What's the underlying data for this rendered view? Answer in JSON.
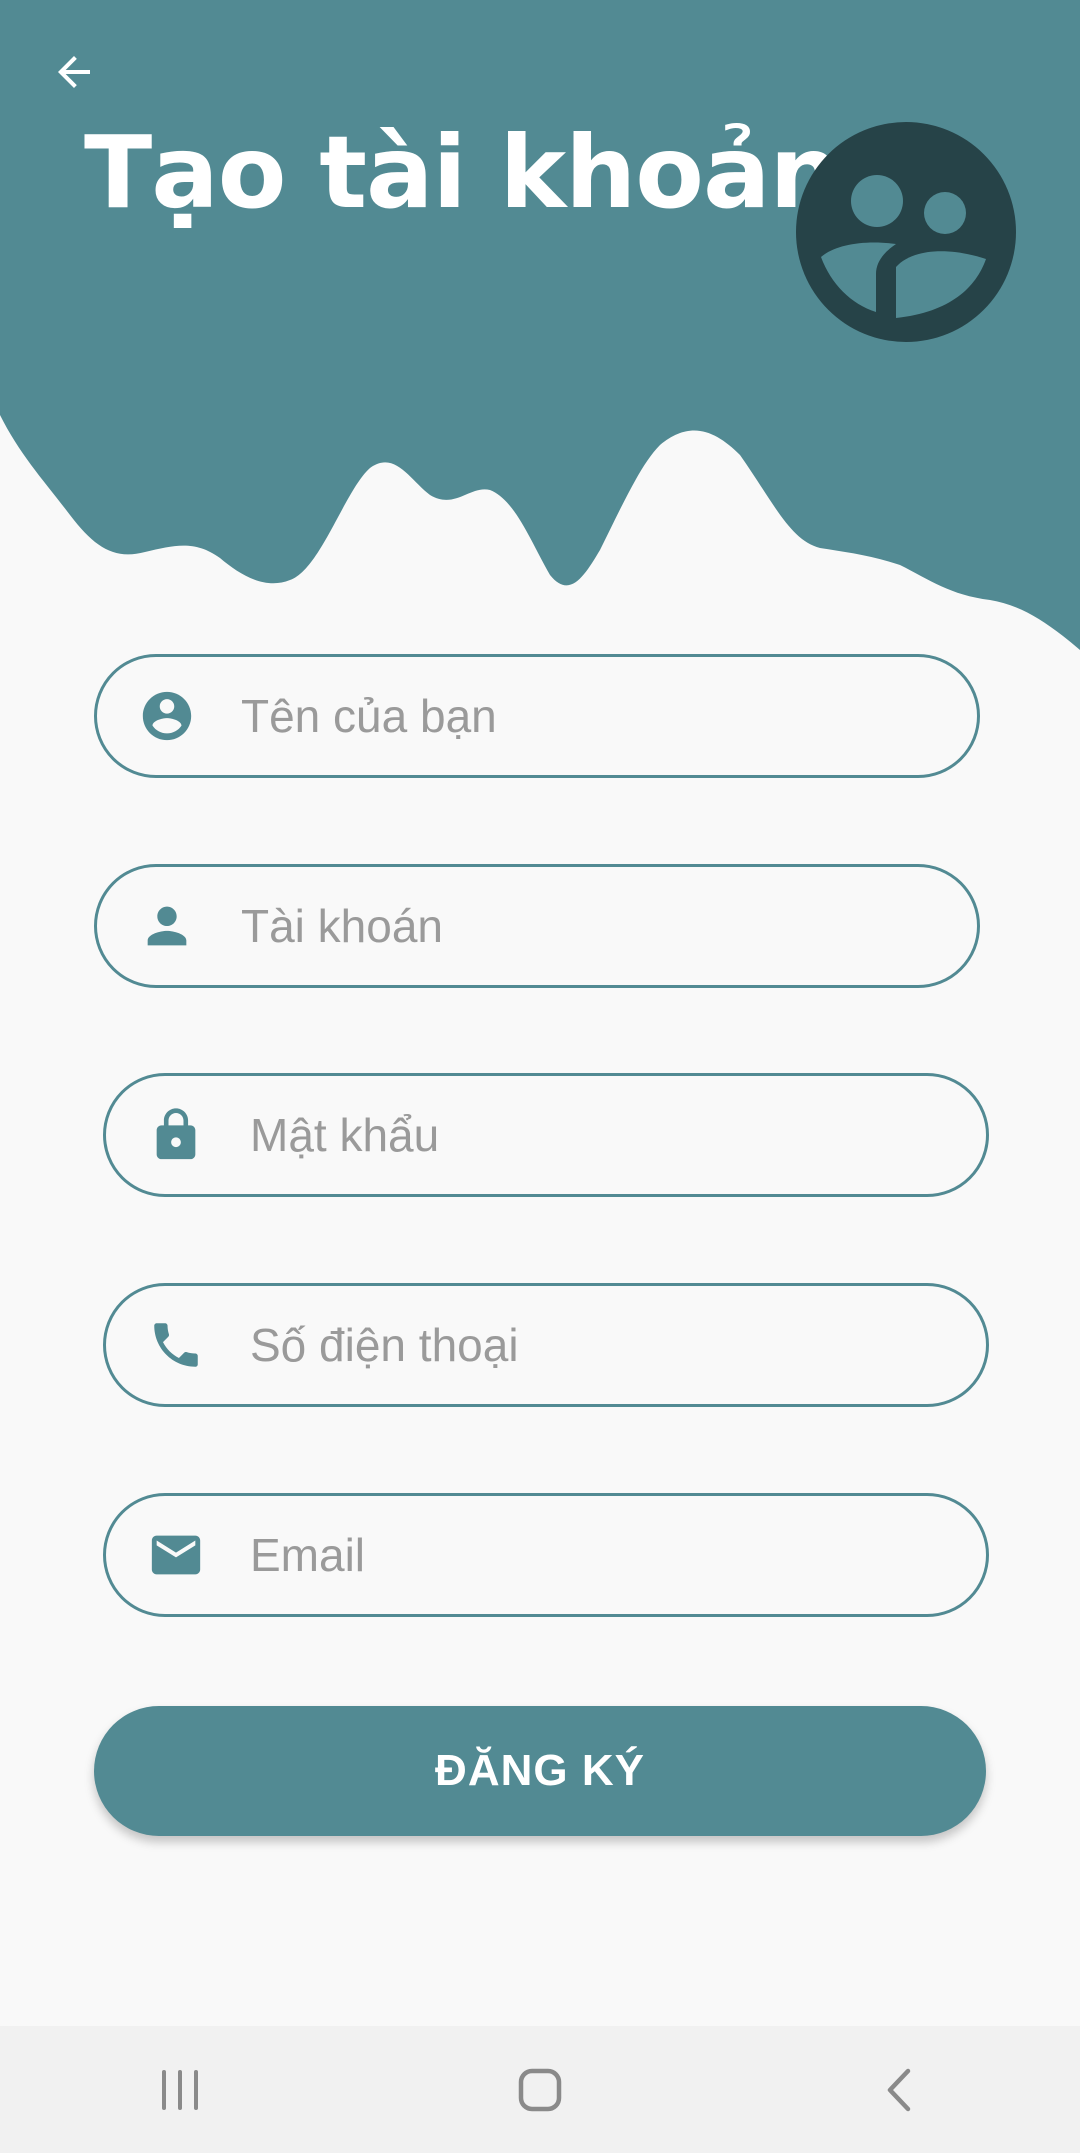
{
  "header": {
    "title": "Tạo tài khoản",
    "back_icon": "arrow-left-icon",
    "badge_icon": "supervisor-account-icon"
  },
  "form": {
    "fields": [
      {
        "icon": "account-circle-icon",
        "placeholder": "Tên của bạn",
        "value": ""
      },
      {
        "icon": "person-icon",
        "placeholder": "Tài khoán",
        "value": ""
      },
      {
        "icon": "lock-icon",
        "placeholder": "Mật khẩu",
        "value": ""
      },
      {
        "icon": "phone-icon",
        "placeholder": "Số điện thoại",
        "value": ""
      },
      {
        "icon": "email-icon",
        "placeholder": "Email",
        "value": ""
      }
    ],
    "submit_label": "ĐĂNG KÝ"
  },
  "navbar": {
    "recents_icon": "recent-apps-icon",
    "home_icon": "home-icon",
    "back_icon": "system-back-icon"
  },
  "colors": {
    "primary": "#528a93",
    "badge": "#264348",
    "background": "#f9f9f9",
    "navbar": "#f1f1f1"
  }
}
